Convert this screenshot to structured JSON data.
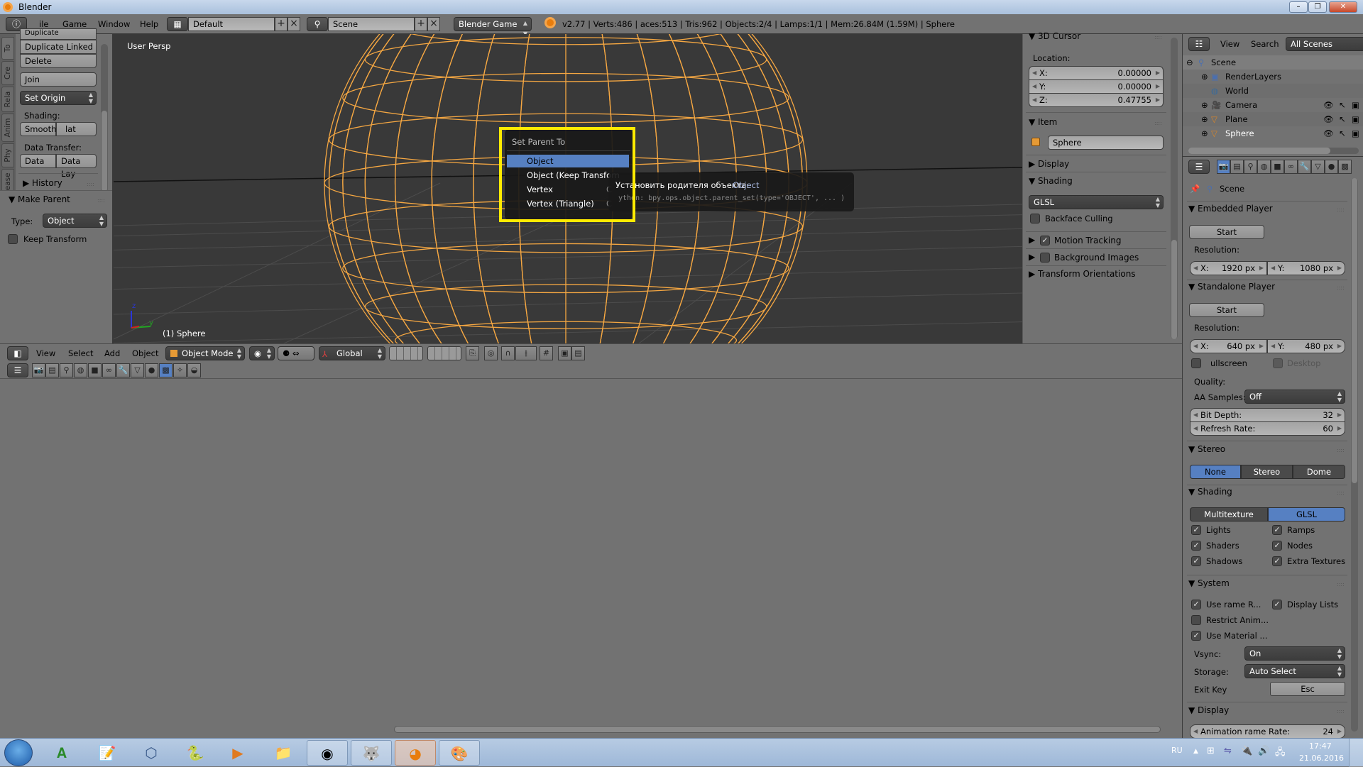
{
  "window": {
    "title": "Blender",
    "controls": [
      "–",
      "❐",
      "✕"
    ]
  },
  "topbar": {
    "menus": [
      "ile",
      "Game",
      "Window",
      "Help"
    ],
    "screen_layout": "Default",
    "scene": "Scene",
    "engine": "Blender Game",
    "stats": "v2.77 | Verts:486 |  aces:513 | Tris:962 | Objects:2/4 | Lamps:1/1 | Mem:26.84M (1.59M) | Sphere"
  },
  "toolshelf": {
    "tabs": [
      "To",
      "Cre",
      "Rela",
      "Anim",
      "Phy",
      "Grease"
    ],
    "buttons": {
      "duplicate": "Duplicate",
      "duplicate_linked": "Duplicate Linked",
      "delete": "Delete",
      "join": "Join"
    },
    "set_origin": "Set Origin",
    "shading_label": "Shading:",
    "shading_smooth": "Smooth",
    "shading_flat": "lat",
    "data_transfer_label": "Data Transfer:",
    "data": "Data",
    "data_layout": "Data Lay",
    "history": "History"
  },
  "operator_panel": {
    "title": "Make Parent",
    "type_label": "Type:",
    "type_value": "Object",
    "keep_transform": "Keep Transform",
    "keep_transform_checked": false
  },
  "viewport": {
    "view_name": "User Persp",
    "object_label": "(1) Sphere",
    "axis_z": "z",
    "axis_y": "y",
    "wire_color": "#f5a742"
  },
  "popup": {
    "title": "Set Parent To",
    "items": [
      {
        "label": "Object",
        "shortcut": "",
        "highlighted": true
      },
      {
        "label": "Object (Keep Transforn",
        "shortcut": "",
        "highlighted": false
      },
      {
        "label": "Vertex",
        "shortcut": "C",
        "highlighted": false
      },
      {
        "label": "Vertex (Triangle)",
        "shortcut": "C",
        "highlighted": false
      }
    ]
  },
  "tooltip": {
    "label": "Установить родителя объекта:",
    "value": "Object",
    "python": "ython: bpy.ops.object.parent_set(type='OBJECT', ... )"
  },
  "npanel": {
    "cursor_title": "3D Cursor",
    "location_label": "Location:",
    "x_label": "X:",
    "x": "0.00000",
    "y_label": "Y:",
    "y": "0.00000",
    "z_label": "Z:",
    "z": "0.47755",
    "item_title": "Item",
    "item_name": "Sphere",
    "display_title": "Display",
    "shading_title": "Shading",
    "shading_mode": "GLSL",
    "backface_culling": "Backface Culling",
    "motion_tracking": "Motion Tracking",
    "background_images": "Background Images",
    "transform_orientations": "Transform Orientations"
  },
  "view_header": {
    "menus": [
      "View",
      "Select",
      "Add",
      "Object"
    ],
    "mode": "Object Mode",
    "orientation": "Global"
  },
  "outliner": {
    "menus": [
      "View",
      "Search"
    ],
    "filter": "All Scenes",
    "rows": [
      {
        "name": "Scene",
        "level": 0
      },
      {
        "name": "RenderLayers",
        "level": 1
      },
      {
        "name": "World",
        "level": 1
      },
      {
        "name": "Camera",
        "level": 1
      },
      {
        "name": "Plane",
        "level": 1
      },
      {
        "name": "Sphere",
        "level": 1
      }
    ]
  },
  "properties": {
    "context": "Scene",
    "embedded_player": {
      "title": "Embedded Player",
      "start": "Start",
      "resolution_label": "Resolution:",
      "x_label": "X:",
      "x": "1920 px",
      "y_label": "Y:",
      "y": "1080 px"
    },
    "standalone_player": {
      "title": "Standalone Player",
      "start": "Start",
      "resolution_label": "Resolution:",
      "x_label": "X:",
      "x": "640 px",
      "y_label": "Y:",
      "y": "480 px",
      "fullscreen": "ullscreen",
      "desktop": "Desktop",
      "quality_label": "Quality:",
      "aa_label": "AA Samples:",
      "aa_value": "Off",
      "bit_depth_label": "Bit Depth:",
      "bit_depth": "32",
      "refresh_label": "Refresh Rate:",
      "refresh": "60"
    },
    "stereo": {
      "title": "Stereo",
      "options": [
        "None",
        "Stereo",
        "Dome"
      ],
      "selected": "None"
    },
    "shading": {
      "title": "Shading",
      "options": [
        "Multitexture",
        "GLSL"
      ],
      "selected": "GLSL",
      "checks": [
        "Lights",
        "Ramps",
        "Shaders",
        "Nodes",
        "Shadows",
        "Extra Textures"
      ]
    },
    "system": {
      "title": "System",
      "use_frame_rate": "Use  rame R...",
      "display_lists": "Display Lists",
      "restrict_anim": "Restrict Anim...",
      "use_material": "Use Material ...",
      "vsync_label": "Vsync:",
      "vsync": "On",
      "storage_label": "Storage:",
      "storage": "Auto Select",
      "exit_key_label": "Exit Key",
      "exit_key": "Esc"
    },
    "display": {
      "title": "Display",
      "anim_label": "Animation  rame Rate:",
      "anim_value": "24"
    }
  },
  "taskbar": {
    "apps": [
      "Start",
      "AkelPad",
      "Notepad++",
      "VirtualBox",
      "Python",
      "Media Player",
      "Explorer",
      "Chrome",
      "GIMP",
      "Blender",
      "Paint"
    ],
    "lang": "RU",
    "time": "17:47",
    "date": "21.06.2016"
  }
}
